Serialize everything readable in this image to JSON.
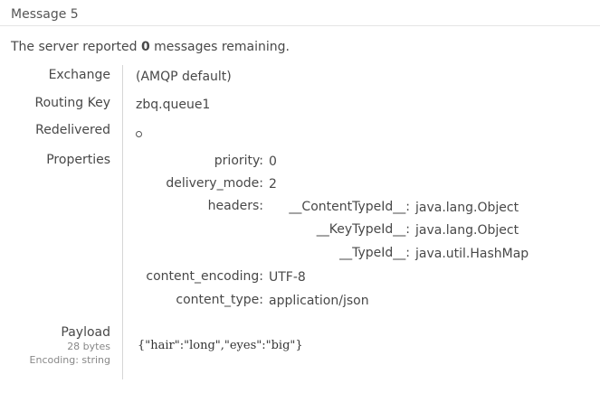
{
  "message": {
    "title": "Message 5",
    "summary_prefix": "The server reported ",
    "remaining_count": "0",
    "summary_suffix": " messages remaining."
  },
  "fields": {
    "exchange_label": "Exchange",
    "exchange_value": "(AMQP default)",
    "routing_key_label": "Routing Key",
    "routing_key_value": "zbq.queue1",
    "redelivered_label": "Redelivered",
    "redelivered_icon": "circle-icon",
    "properties_label": "Properties"
  },
  "properties": {
    "priority_label": "priority:",
    "priority_value": "0",
    "delivery_mode_label": "delivery_mode:",
    "delivery_mode_value": "2",
    "headers_label": "headers:",
    "content_encoding_label": "content_encoding:",
    "content_encoding_value": "UTF-8",
    "content_type_label": "content_type:",
    "content_type_value": "application/json"
  },
  "headers": [
    {
      "key": "__ContentTypeId__:",
      "value": "java.lang.Object"
    },
    {
      "key": "__KeyTypeId__:",
      "value": "java.lang.Object"
    },
    {
      "key": "__TypeId__:",
      "value": "java.util.HashMap"
    }
  ],
  "payload": {
    "label": "Payload",
    "size": "28 bytes",
    "encoding": "Encoding: string",
    "body": "{\"hair\":\"long\",\"eyes\":\"big\"}"
  }
}
